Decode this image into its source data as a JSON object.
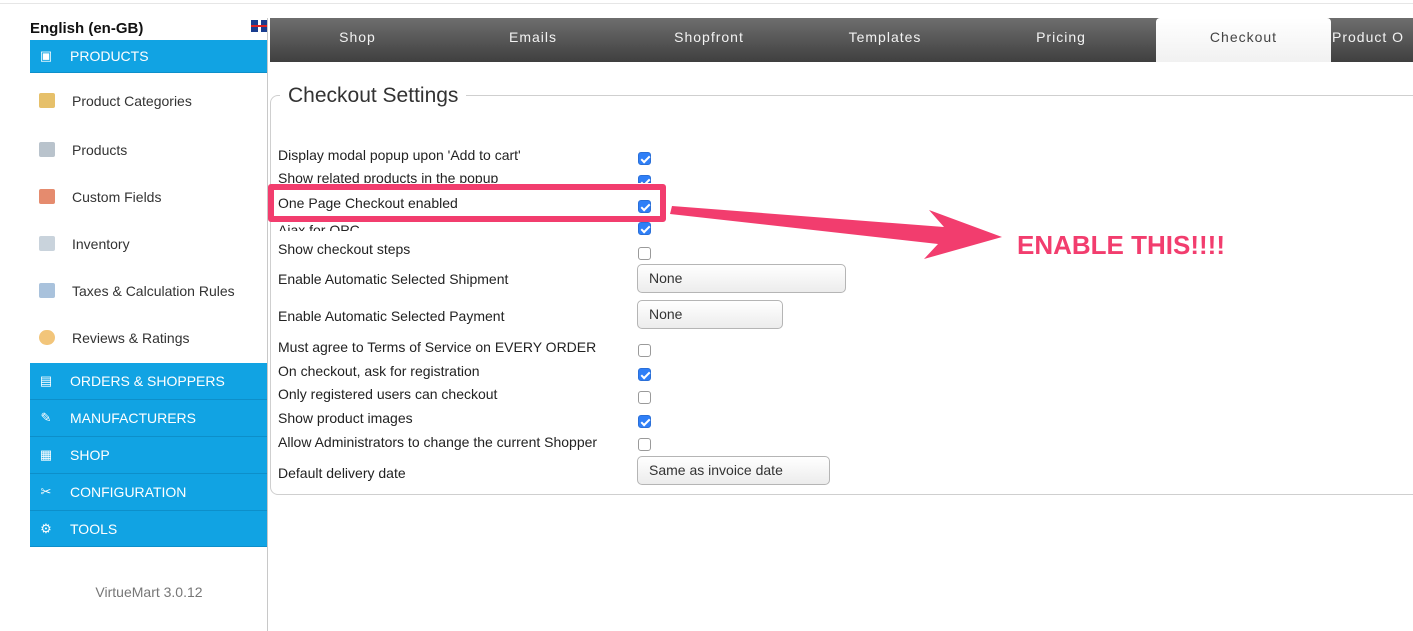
{
  "sidebar": {
    "language": "English (en-GB)",
    "sections": [
      {
        "label": "PRODUCTS",
        "icon": "folder-icon"
      },
      {
        "label": "ORDERS & SHOPPERS",
        "icon": "orders-icon"
      },
      {
        "label": "MANUFACTURERS",
        "icon": "wrench-icon"
      },
      {
        "label": "SHOP",
        "icon": "shop-icon"
      },
      {
        "label": "CONFIGURATION",
        "icon": "tools-icon"
      },
      {
        "label": "TOOLS",
        "icon": "gear-icon"
      }
    ],
    "product_items": [
      {
        "label": "Product Categories",
        "icon": "categories-icon"
      },
      {
        "label": "Products",
        "icon": "products-icon"
      },
      {
        "label": "Custom Fields",
        "icon": "custom-fields-icon"
      },
      {
        "label": "Inventory",
        "icon": "inventory-icon"
      },
      {
        "label": "Taxes & Calculation Rules",
        "icon": "calculator-icon"
      },
      {
        "label": "Reviews & Ratings",
        "icon": "speech-bubble-icon"
      }
    ],
    "version": "VirtueMart 3.0.12"
  },
  "tabs": [
    "Shop",
    "Emails",
    "Shopfront",
    "Templates",
    "Pricing",
    "Checkout",
    "Product O"
  ],
  "active_tab": "Checkout",
  "settings": {
    "title": "Checkout Settings",
    "rows": [
      {
        "label": "Display modal popup upon 'Add to cart'",
        "checked": true
      },
      {
        "label": "Show related products in the popup",
        "checked": true
      },
      {
        "label": "One Page Checkout enabled",
        "checked": true
      },
      {
        "label": "Ajax for OPC",
        "checked": true
      },
      {
        "label": "Show checkout steps",
        "checked": false
      },
      {
        "label": "Enable Automatic Selected Shipment",
        "select": "None"
      },
      {
        "label": "Enable Automatic Selected Payment",
        "select": "None"
      },
      {
        "label": "Must agree to Terms of Service on EVERY ORDER",
        "checked": false
      },
      {
        "label": "On checkout, ask for registration",
        "checked": true
      },
      {
        "label": "Only registered users can checkout",
        "checked": false
      },
      {
        "label": "Show product images",
        "checked": true
      },
      {
        "label": "Allow Administrators to change the current Shopper",
        "checked": false
      },
      {
        "label": "Default delivery date",
        "select": "Same as invoice date"
      }
    ]
  },
  "annotation": {
    "text": "ENABLE THIS!!!!"
  },
  "colors": {
    "accent": "#11a3e3",
    "annotation": "#f23d6e",
    "checkbox": "#2f7ff7"
  }
}
